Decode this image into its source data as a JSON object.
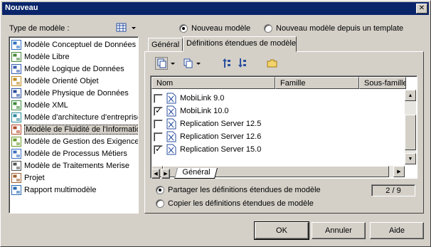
{
  "window": {
    "title": "Nouveau",
    "close_glyph": "✕"
  },
  "left": {
    "type_label": "Type de modèle :",
    "items": [
      {
        "label": "Modèle Conceptuel de Données",
        "icon": "mcd-icon",
        "color": "#2f6fc0"
      },
      {
        "label": "Modèle Libre",
        "icon": "free-model-icon",
        "color": "#4a8a3a"
      },
      {
        "label": "Modèle Logique de Données",
        "icon": "mld-icon",
        "color": "#3a5fb0"
      },
      {
        "label": "Modèle Orienté Objet",
        "icon": "moo-icon",
        "color": "#c08a20"
      },
      {
        "label": "Modèle Physique de Données",
        "icon": "mpd-icon",
        "color": "#2a4f9f"
      },
      {
        "label": "Modèle XML",
        "icon": "xml-icon",
        "color": "#3b8a3b"
      },
      {
        "label": "Modèle d'architecture d'entreprise",
        "icon": "ea-icon",
        "color": "#2a8a9a"
      },
      {
        "label": "Modèle de Fluidité de l'Information",
        "icon": "ilm-icon",
        "color": "#b04a2a",
        "selected": true
      },
      {
        "label": "Modèle de Gestion des Exigences",
        "icon": "rqm-icon",
        "color": "#6a9a2a"
      },
      {
        "label": "Modèle de Processus Métiers",
        "icon": "bpm-icon",
        "color": "#3a70c0"
      },
      {
        "label": "Modèle de Traitements Merise",
        "icon": "merise-icon",
        "color": "#555555"
      },
      {
        "label": "Projet",
        "icon": "project-icon",
        "color": "#a06030"
      },
      {
        "label": "Rapport multimodèle",
        "icon": "report-icon",
        "color": "#2a6ab0"
      }
    ]
  },
  "top_radios": {
    "new_model": "Nouveau modèle",
    "from_template": "Nouveau modèle depuis un template"
  },
  "tabs": {
    "general": "Général",
    "extended": "Définitions étendues de modèle"
  },
  "list": {
    "columns": {
      "name": "Nom",
      "family": "Famille",
      "subfamily": "Sous-famille"
    },
    "rows": [
      {
        "name": "MobiLink 9.0",
        "checked": false
      },
      {
        "name": "MobiLink 10.0",
        "checked": true
      },
      {
        "name": "Replication Server 12.5",
        "checked": false
      },
      {
        "name": "Replication Server 12.6",
        "checked": false
      },
      {
        "name": "Replication Server 15.0",
        "checked": true
      }
    ],
    "sheet_tab": "Général"
  },
  "options": {
    "share": "Partager les définitions étendues de modèle",
    "copy": "Copier les définitions étendues de modèle",
    "counter": "2 / 9"
  },
  "buttons": {
    "ok": "OK",
    "cancel": "Annuler",
    "help": "Aide"
  }
}
